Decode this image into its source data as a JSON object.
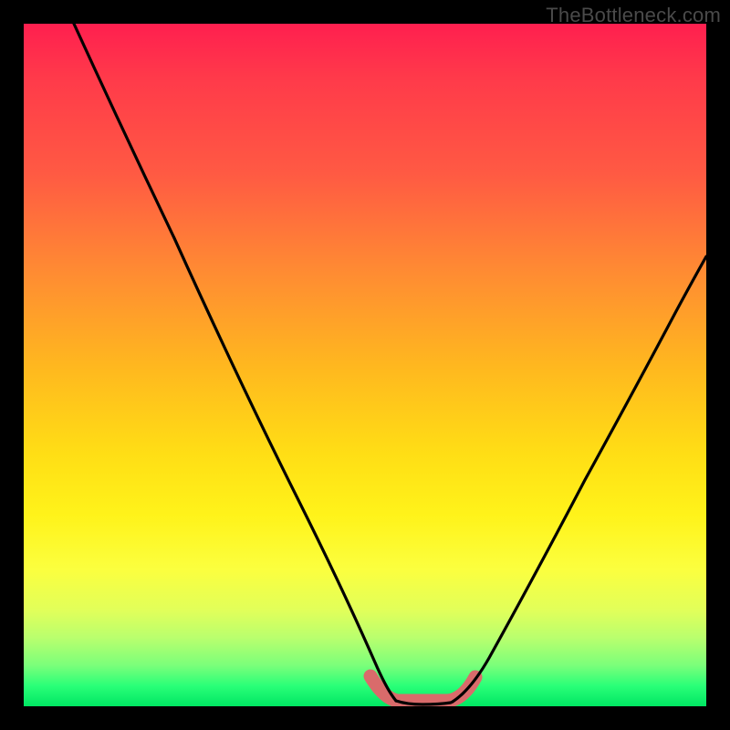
{
  "watermark": "TheBottleneck.com",
  "colors": {
    "background": "#000000",
    "curve": "#000000",
    "highlight": "#d96b6b",
    "gradient_top": "#ff1f4f",
    "gradient_bottom": "#00e663"
  },
  "chart_data": {
    "type": "line",
    "title": "",
    "xlabel": "",
    "ylabel": "",
    "xlim": [
      0,
      100
    ],
    "ylim": [
      0,
      100
    ],
    "grid": false,
    "note": "Bottleneck-style V curve: y ≈ 100 at edges, y ≈ 0 at the flat trough around x 55–63. Values estimated from pixel positions (no axis ticks present).",
    "series": [
      {
        "name": "left-branch",
        "x": [
          8,
          12,
          16,
          20,
          24,
          28,
          32,
          36,
          40,
          44,
          48,
          51,
          53,
          55
        ],
        "y": [
          100,
          92,
          84,
          75,
          66,
          57,
          48,
          40,
          31,
          22,
          13,
          7,
          3,
          1
        ]
      },
      {
        "name": "trough",
        "x": [
          55,
          57,
          59,
          61,
          63
        ],
        "y": [
          1,
          0.5,
          0.5,
          0.5,
          1
        ]
      },
      {
        "name": "right-branch",
        "x": [
          63,
          66,
          70,
          74,
          78,
          82,
          86,
          90,
          94,
          98,
          100
        ],
        "y": [
          1,
          4,
          10,
          18,
          26,
          34,
          42,
          50,
          57,
          63,
          66
        ]
      },
      {
        "name": "highlight-region",
        "x": [
          52,
          55,
          59,
          63,
          65
        ],
        "y": [
          4,
          1,
          0.5,
          1,
          3
        ]
      }
    ]
  }
}
